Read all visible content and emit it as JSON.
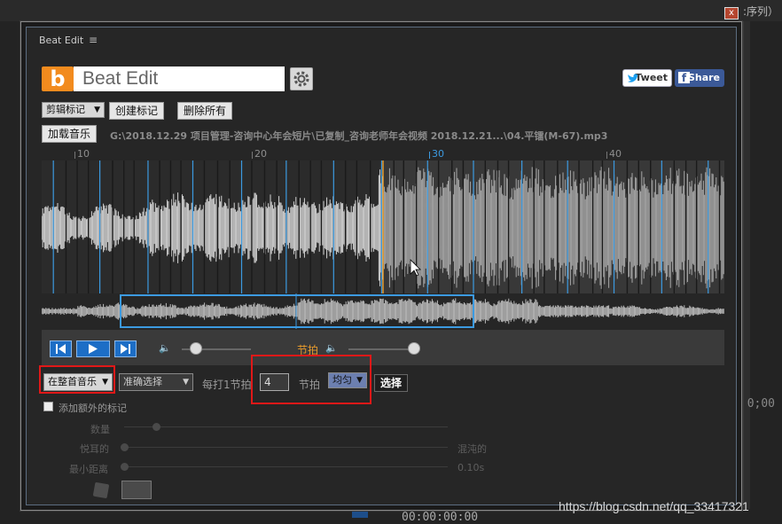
{
  "background": {
    "top_right_text": ":序列）",
    "timecode_right": "0;00",
    "timecode_bottom": "00:00:00:00",
    "close_label": "x"
  },
  "panel": {
    "title": "Beat Edit",
    "menu_icon": "hamburger-icon"
  },
  "header": {
    "logo_letter": "b",
    "app_title": "Beat Edit",
    "settings_icon": "gear-icon",
    "tweet_label": "Tweet",
    "share_label": "Share",
    "twitter_icon": "twitter-bird-icon",
    "facebook_icon": "facebook-icon"
  },
  "markers": {
    "dropdown_value": "剪辑标记",
    "create_label": "创建标记",
    "remove_all_label": "删除所有"
  },
  "music": {
    "load_label": "加载音乐",
    "file_path": "G:\\2018.12.29 项目管理-咨询中心年会短片\\已复制_咨询老师年会视频 2018.12.21...\\04.平镭(M-67).mp3"
  },
  "ruler": {
    "labels": [
      "10",
      "20",
      "30",
      "40"
    ],
    "highlighted": "30"
  },
  "transport": {
    "prev_icon": "skip-to-start-icon",
    "play_icon": "play-icon",
    "next_icon": "skip-to-end-icon",
    "music_volume_icon": "speaker-icon",
    "beat_label": "节拍",
    "beat_volume_icon": "speaker-icon",
    "music_volume_level": 0.2,
    "beat_volume_level": 0.95
  },
  "options": {
    "scope_value": "在整首音乐",
    "mode_value": "准确选择",
    "every_label": "每打1节拍",
    "beat_count": "4",
    "beat_unit_label": "节拍",
    "distribution_value": "均匀",
    "select_label": "选择"
  },
  "extra": {
    "add_extra_label": "添加额外的标记",
    "count_label": "数量",
    "pleasant_label": "悦耳的",
    "chaotic_label": "混沌的",
    "min_distance_label": "最小距离",
    "min_distance_value": "0.10s",
    "dice_icon": "dice-icon"
  },
  "watermark": "https://blog.csdn.net/qq_33417321"
}
